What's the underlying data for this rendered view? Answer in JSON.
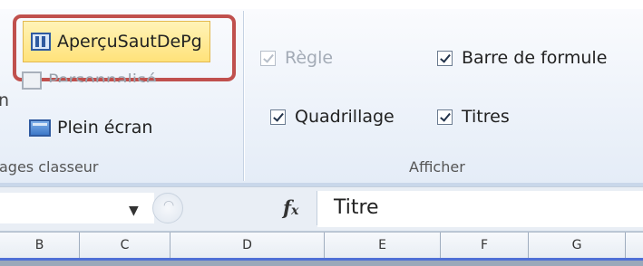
{
  "ribbon": {
    "view_group": {
      "apercu_label": "AperçuSautDePg",
      "personnalise_label": "Personnalisé",
      "plein_ecran_label": "Plein écran",
      "left_cut_label": "n",
      "group_label": "ages classeur"
    },
    "afficher_group": {
      "regle_label": "Règle",
      "regle_checked": true,
      "regle_enabled": false,
      "barre_formule_label": "Barre de formule",
      "barre_formule_checked": true,
      "quadrillage_label": "Quadrillage",
      "quadrillage_checked": true,
      "titres_label": "Titres",
      "titres_checked": true,
      "group_label": "Afficher"
    }
  },
  "formula_bar": {
    "fx_symbol": "fx",
    "value": "Titre",
    "dropdown_glyph": "▼",
    "cancel_glyph": "◠"
  },
  "columns": [
    "B",
    "C",
    "D",
    "E",
    "F",
    "G"
  ],
  "colors": {
    "highlight_border": "#c0504d",
    "active_button_fill": "#ffe27a",
    "selection_line": "#4f6fd6"
  }
}
